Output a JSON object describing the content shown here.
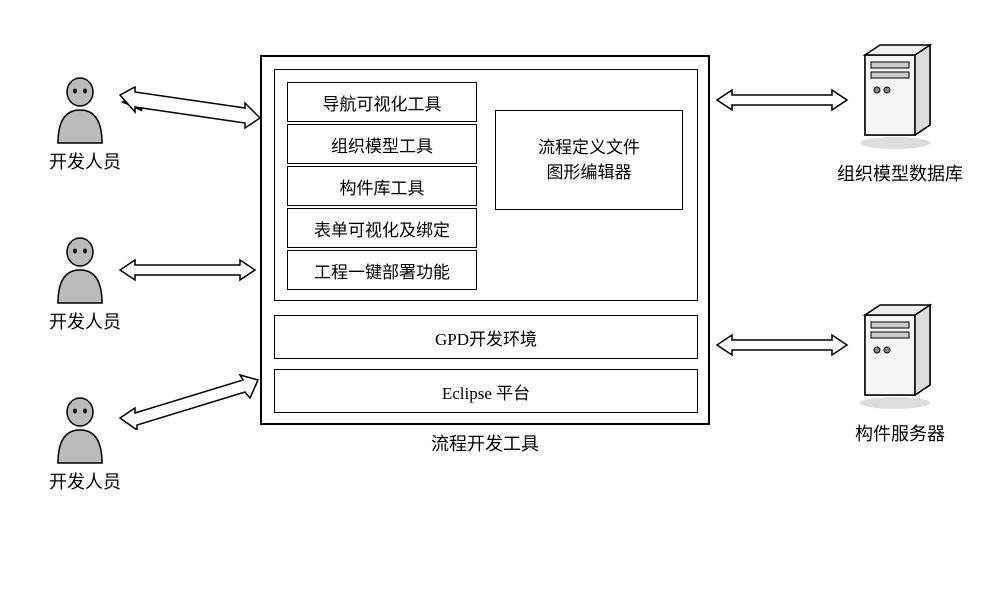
{
  "actors": {
    "dev1": "开发人员",
    "dev2": "开发人员",
    "dev3": "开发人员"
  },
  "servers": {
    "model_db": "组织模型数据库",
    "component_server": "构件服务器"
  },
  "main_box_label": "流程开发工具",
  "tools": {
    "nav_visual": "导航可视化工具",
    "org_model": "组织模型工具",
    "component_lib": "构件库工具",
    "form_visual": "表单可视化及绑定",
    "deploy": "工程一键部署功能"
  },
  "editor": "流程定义文件\n图形编辑器",
  "gpd_env": "GPD开发环境",
  "eclipse": "Eclipse 平台"
}
